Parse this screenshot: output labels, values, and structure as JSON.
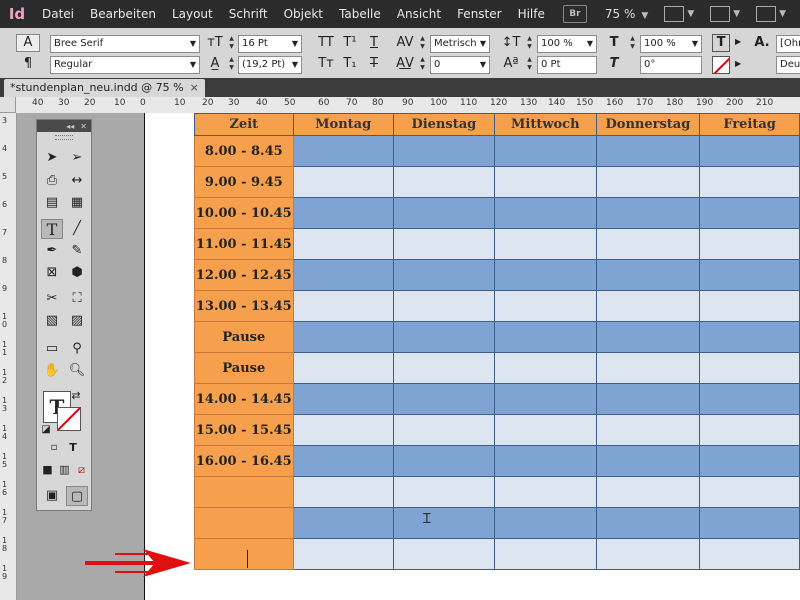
{
  "app": {
    "logo": "Id"
  },
  "menu": [
    "Datei",
    "Bearbeiten",
    "Layout",
    "Schrift",
    "Objekt",
    "Tabelle",
    "Ansicht",
    "Fenster",
    "Hilfe"
  ],
  "menubar": {
    "bridge": "Br",
    "zoom": "75 %"
  },
  "control": {
    "font_family": "Bree Serif",
    "font_style": "Regular",
    "font_size": "16 Pt",
    "leading": "(19,2 Pt)",
    "kerning": "Metrisch",
    "tracking": "0",
    "vscale": "100 %",
    "hscale": "100 %",
    "baseline": "0 Pt",
    "skew": "0°",
    "char_style": "[Ohn",
    "language": "Deut"
  },
  "document_tab": {
    "title": "*stundenplan_neu.indd @ 75 %",
    "close": "×"
  },
  "ruler": {
    "h_labels": [
      "40",
      "30",
      "20",
      "10",
      "0",
      "10",
      "20",
      "30",
      "40",
      "50",
      "60",
      "70",
      "80",
      "90",
      "100",
      "110",
      "120",
      "130",
      "140",
      "150",
      "160",
      "170",
      "180",
      "190",
      "200",
      "210"
    ],
    "v_labels": [
      "3",
      "4",
      "5",
      "6",
      "7",
      "8",
      "9",
      "10",
      "11",
      "12",
      "13",
      "14",
      "15",
      "16",
      "17",
      "18",
      "19"
    ]
  },
  "table": {
    "headers": [
      "Zeit",
      "Montag",
      "Dienstag",
      "Mittwoch",
      "Donnerstag",
      "Freitag"
    ],
    "rows": [
      "8.00 - 8.45",
      "9.00 - 9.45",
      "10.00 - 10.45",
      "11.00 - 11.45",
      "12.00 - 12.45",
      "13.00 - 13.45",
      "Pause",
      "Pause",
      "14.00 - 14.45",
      "15.00 - 15.45",
      "16.00 - 16.45",
      "",
      "",
      ""
    ]
  },
  "colors": {
    "orange": "#f6a04d",
    "blue_dark": "#7fa4d3",
    "blue_light": "#dde5f1",
    "arrow": "#e01010"
  }
}
